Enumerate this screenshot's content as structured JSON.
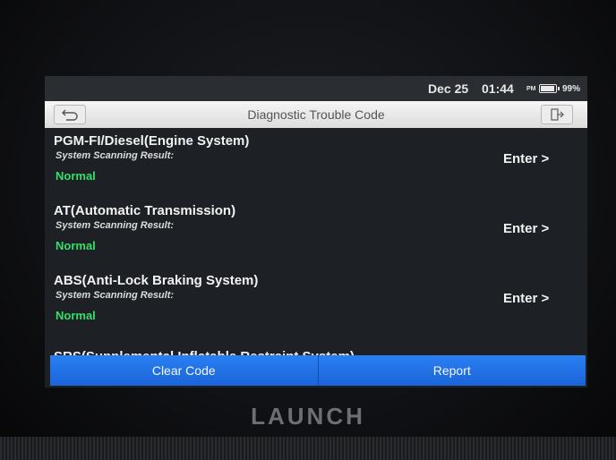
{
  "status": {
    "date": "Dec 25",
    "time": "01:44",
    "ampm": "PM",
    "battery": "99%",
    "battery_level": 0.99
  },
  "header": {
    "title": "Diagnostic Trouble Code",
    "back_icon": "back-arrow-icon",
    "exit_icon": "exit-door-icon"
  },
  "systems": [
    {
      "name": "PGM-FI/Diesel(Engine System)",
      "result_label": "System Scanning Result:",
      "status": "Normal",
      "enter": "Enter >"
    },
    {
      "name": "AT(Automatic Transmission)",
      "result_label": "System Scanning Result:",
      "status": "Normal",
      "enter": "Enter >"
    },
    {
      "name": "ABS(Anti-Lock Braking System)",
      "result_label": "System Scanning Result:",
      "status": "Normal",
      "enter": "Enter >"
    },
    {
      "name": "SRS(Supplemental Inflatable Restraint System)"
    }
  ],
  "actions": {
    "clear": "Clear Code",
    "report": "Report"
  },
  "brand": "LAUNCH",
  "colors": {
    "status_normal": "#35e06a",
    "action_blue": "#1a6fe8"
  }
}
